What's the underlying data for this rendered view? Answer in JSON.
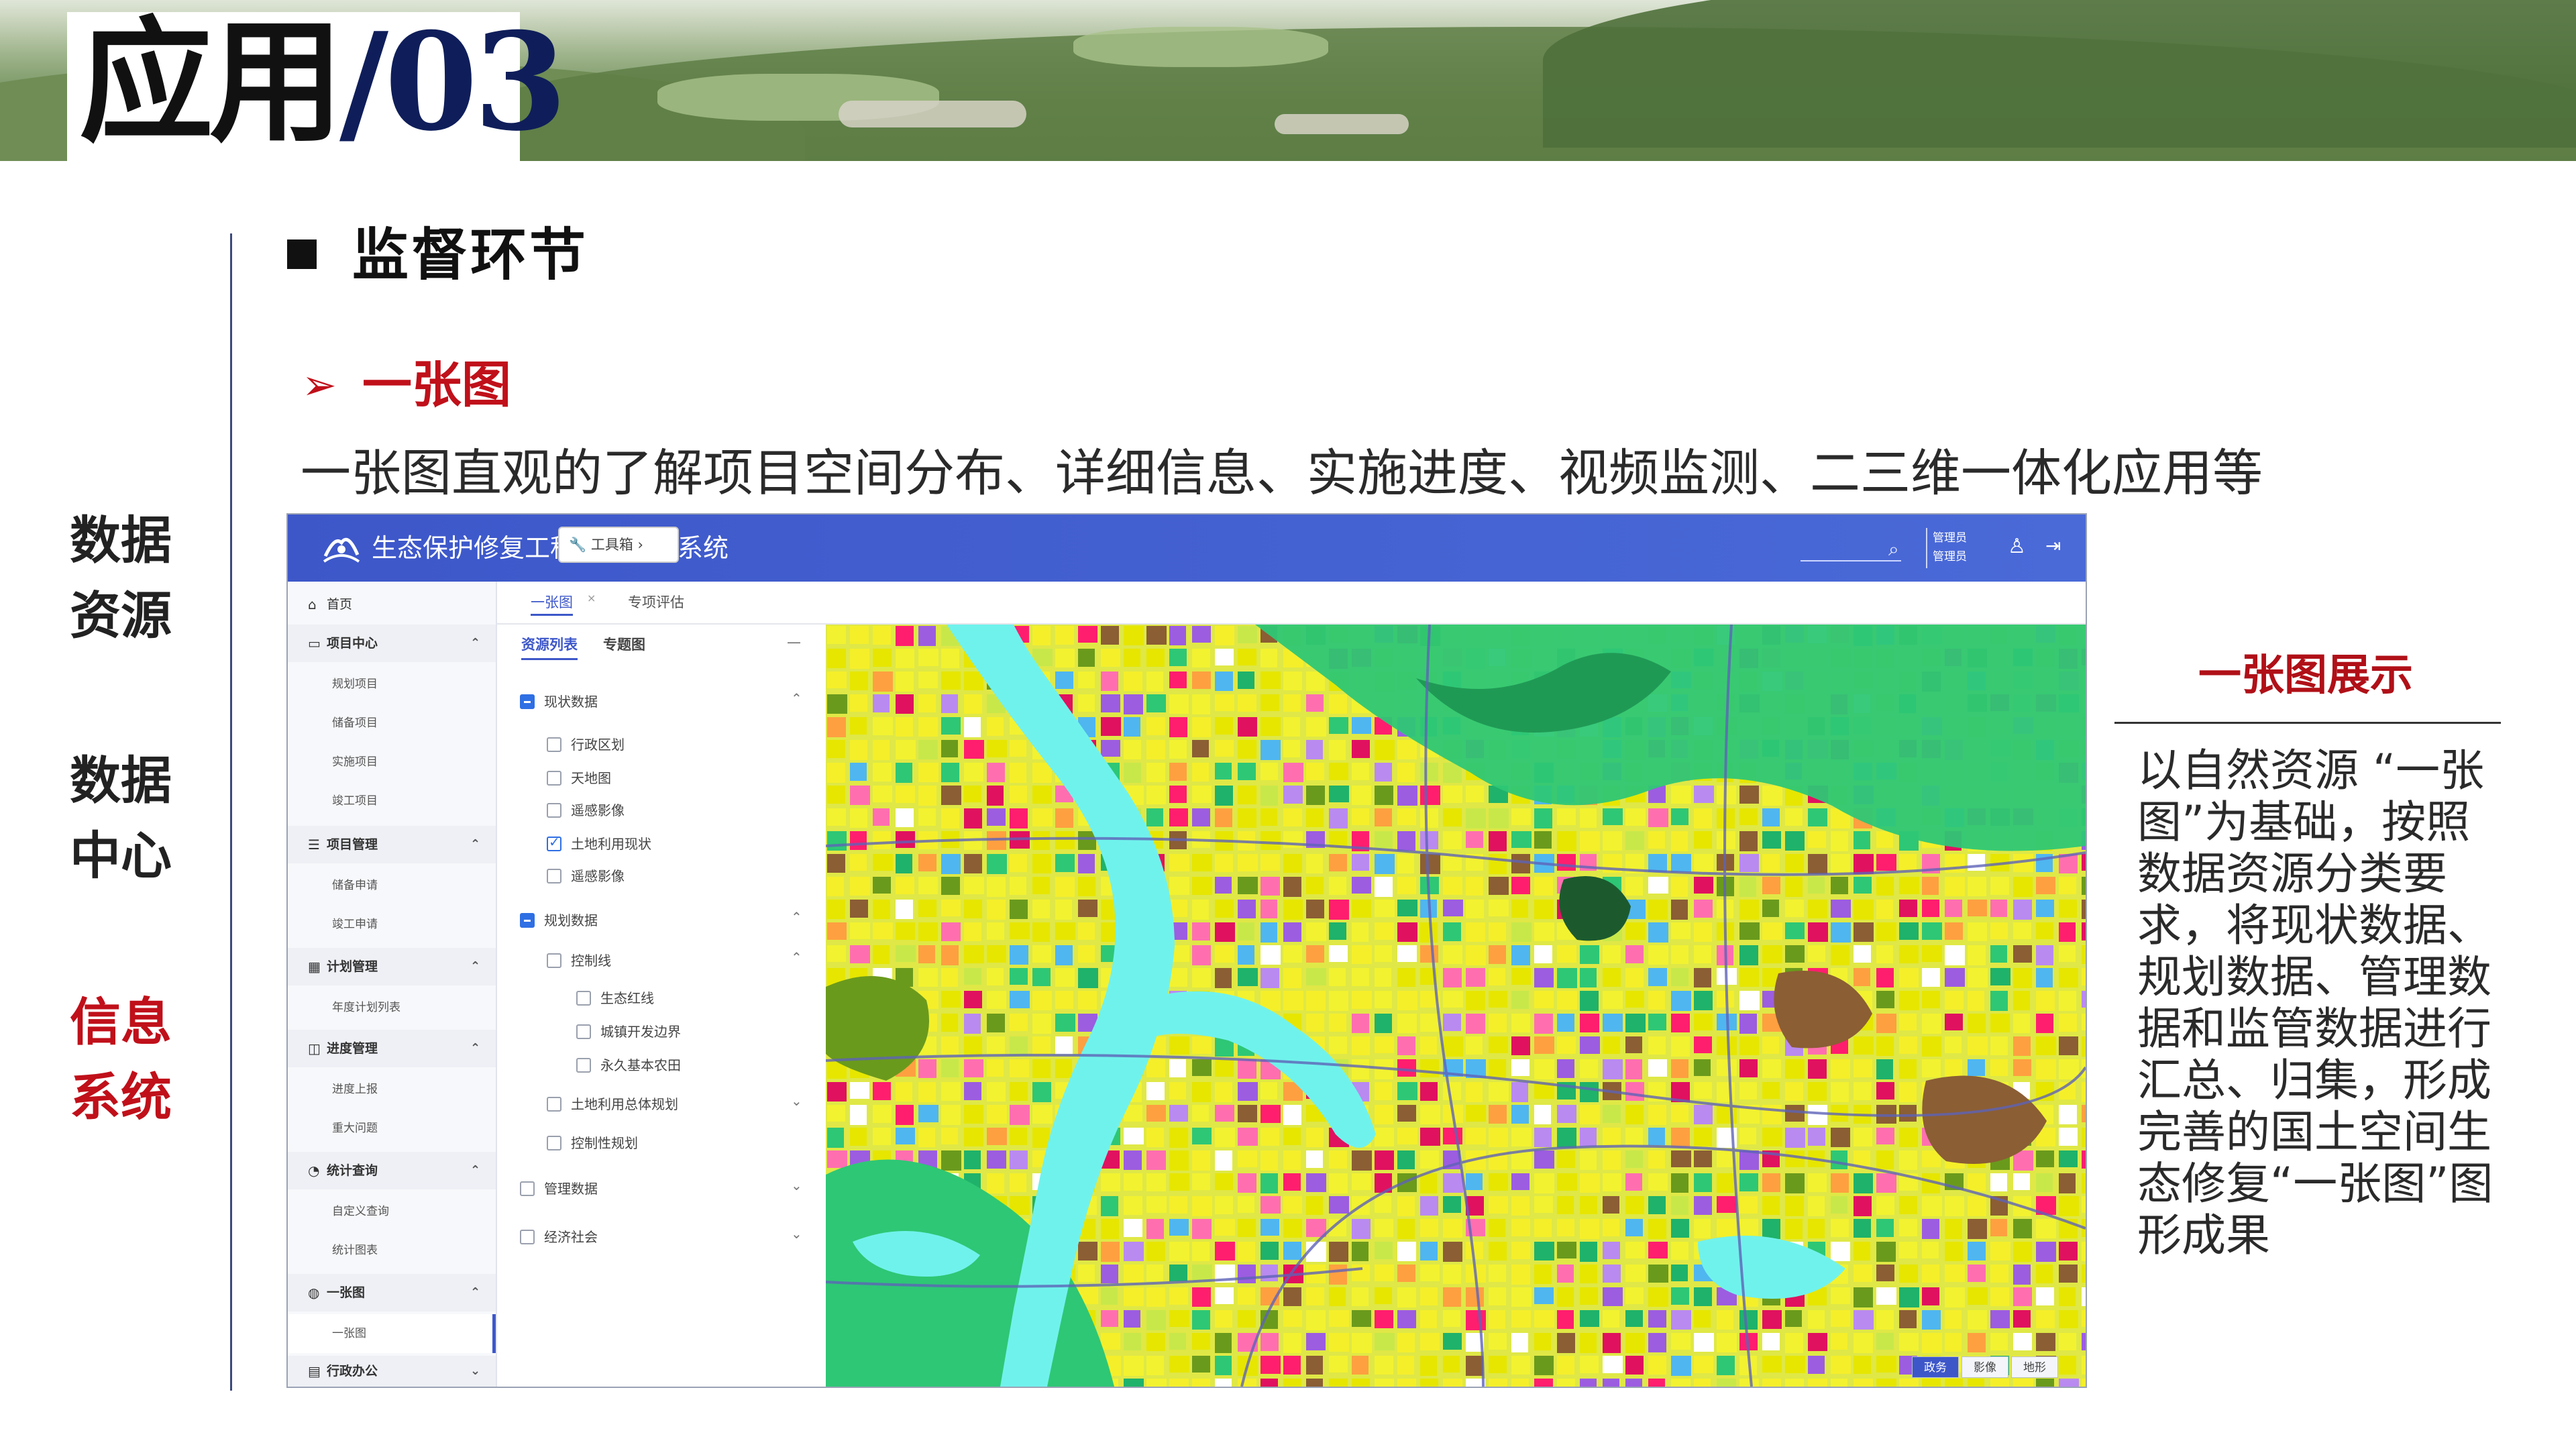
{
  "slide": {
    "title": "应用/03",
    "title_prefix": "应用",
    "title_number": "/03",
    "section_heading": "监督环节",
    "subsection_heading": "一张图",
    "description": "一张图直观的了解项目空间分布、详细信息、实施进度、视频监测、二三维一体化应用等",
    "left_nav": [
      {
        "line1": "数据",
        "line2": "资源"
      },
      {
        "line1": "数据",
        "line2": "中心"
      },
      {
        "line1": "信息",
        "line2": "系统"
      }
    ],
    "right_panel": {
      "title": "一张图展示",
      "text": "以自然资源 “一张图”为基础，按照数据资源分类要求，将现状数据、规划数据、管理数据和监管数据进行汇总、归集，形成完善的国土空间生态修复“一张图”图形成果"
    }
  },
  "app": {
    "title": "生态保护修复工程管理信息系统",
    "user": {
      "line1": "管理员",
      "line2": "管理员"
    },
    "brand_color": "#3d57c9",
    "sidebar": [
      {
        "label": "首页",
        "icon": "home-icon"
      },
      {
        "label": "项目中心",
        "icon": "folder-icon",
        "children": [
          "规划项目",
          "储备项目",
          "实施项目",
          "竣工项目"
        ]
      },
      {
        "label": "项目管理",
        "icon": "list-icon",
        "children": [
          "储备申请",
          "竣工申请"
        ]
      },
      {
        "label": "计划管理",
        "icon": "calendar-icon",
        "children": [
          "年度计划列表"
        ]
      },
      {
        "label": "进度管理",
        "icon": "progress-icon",
        "children": [
          "进度上报",
          "重大问题"
        ]
      },
      {
        "label": "统计查询",
        "icon": "pie-icon",
        "children": [
          "自定义查询",
          "统计图表"
        ]
      },
      {
        "label": "一张图",
        "icon": "globe-icon",
        "children": [
          "一张图"
        ]
      },
      {
        "label": "行政办公",
        "icon": "office-icon"
      }
    ],
    "tabs": [
      "一张图",
      "专项评估"
    ],
    "tab_close": "×",
    "layer_panel": {
      "tabs": [
        "资源列表",
        "专题图"
      ],
      "collapse": "—",
      "groups": [
        {
          "label": "现状数据",
          "items": [
            "行政区划",
            "天地图",
            "遥感影像",
            "土地利用现状",
            "遥感影像"
          ]
        },
        {
          "label": "规划数据",
          "items": [
            "控制线",
            "生态红线",
            "城镇开发边界",
            "永久基本农田",
            "土地利用总体规划",
            "控制性规划"
          ]
        },
        {
          "label": "管理数据"
        },
        {
          "label": "经济社会"
        }
      ]
    },
    "map": {
      "toolbox": "工具箱",
      "basemap_buttons": [
        "政务",
        "影像",
        "地形"
      ]
    }
  }
}
